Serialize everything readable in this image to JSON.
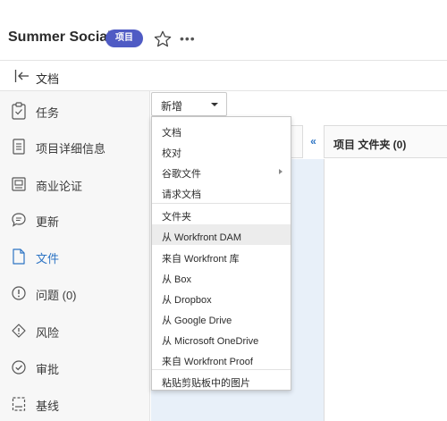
{
  "header": {
    "title": "Summer Social",
    "badge": "项目",
    "more": "•••"
  },
  "breadcrumb": {
    "label": "文档"
  },
  "sidebar": {
    "items": [
      {
        "label": "任务",
        "icon": "task-checklist-icon"
      },
      {
        "label": "项目详细信息",
        "icon": "document-icon"
      },
      {
        "label": "商业论证",
        "icon": "business-case-icon"
      },
      {
        "label": "更新",
        "icon": "chat-bubble-icon"
      },
      {
        "label": "文件",
        "icon": "file-icon",
        "active": true
      },
      {
        "label": "问题 (0)",
        "icon": "issue-icon"
      },
      {
        "label": "风险",
        "icon": "risk-icon"
      },
      {
        "label": "审批",
        "icon": "approval-check-icon"
      },
      {
        "label": "基线",
        "icon": "baseline-icon"
      }
    ]
  },
  "toolbar": {
    "new_label": "新增"
  },
  "panel": {
    "collapse": "«",
    "folder_title": "项目 文件夹 (0)"
  },
  "menu": {
    "items": [
      "文档",
      "校对",
      "谷歌文件",
      "请求文档",
      "文件夹",
      "从 Workfront DAM",
      "来自 Workfront 库",
      "从 Box",
      "从 Dropbox",
      "从 Google Drive",
      "从 Microsoft OneDrive",
      "来自 Workfront Proof",
      "粘贴剪贴板中的图片"
    ]
  },
  "colors": {
    "accent": "#2d74c4",
    "badge": "#4f5bc4",
    "highlight": "#ececec"
  }
}
